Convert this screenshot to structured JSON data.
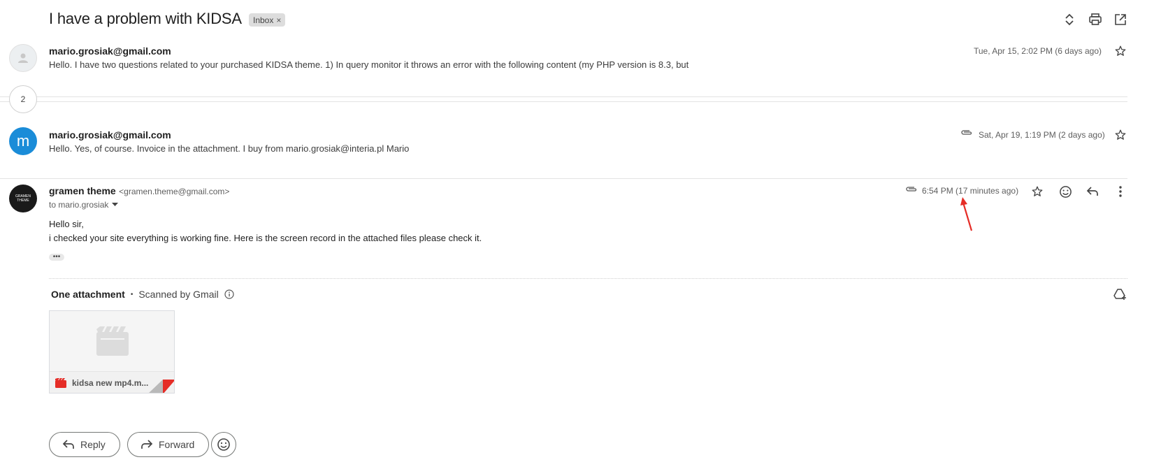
{
  "thread": {
    "subject": "I have a problem with KIDSA",
    "label": "Inbox",
    "label_remove": "×"
  },
  "toolbar": {
    "icons": [
      "expand-collapse-icon",
      "print-icon",
      "open-new-window-icon"
    ]
  },
  "messages": [
    {
      "sender": "mario.grosiak@gmail.com",
      "snippet": "Hello. I have two questions related to your purchased KIDSA theme. 1) In query monitor it throws an error with the following content (my PHP version is 8.3, but",
      "date": "Tue, Apr 15, 2:02 PM (6 days ago)"
    },
    {
      "collapsed_count": "2"
    },
    {
      "sender": "mario.grosiak@gmail.com",
      "avatar_letter": "m",
      "avatar_color": "#1a8cd8",
      "snippet": "Hello. Yes, of course. Invoice in the attachment. I buy from mario.grosiak@interia.pl Mario",
      "date": "Sat, Apr 19, 1:19 PM (2 days ago)",
      "has_attachment": true
    }
  ],
  "open_message": {
    "sender_name": "gramen theme",
    "sender_email": "<gramen.theme@gmail.com>",
    "avatar_text_line1": "GRAMEN",
    "avatar_text_line2": "THEME",
    "to_line": "to mario.grosiak",
    "date": "6:54 PM (17 minutes ago)",
    "body_line1": "Hello sir,",
    "body_line2": "i checked your site everything is working fine. Here is the screen record in the attached files please check it.",
    "ellipsis": "•••"
  },
  "attachments": {
    "title": "One attachment",
    "separator": "•",
    "scanned": "Scanned by Gmail",
    "file_name": "kidsa new mp4.m..."
  },
  "actions": {
    "reply": "Reply",
    "forward": "Forward"
  },
  "colors": {
    "accent_red": "#e52d27",
    "avatar_blue": "#1a8cd8"
  }
}
